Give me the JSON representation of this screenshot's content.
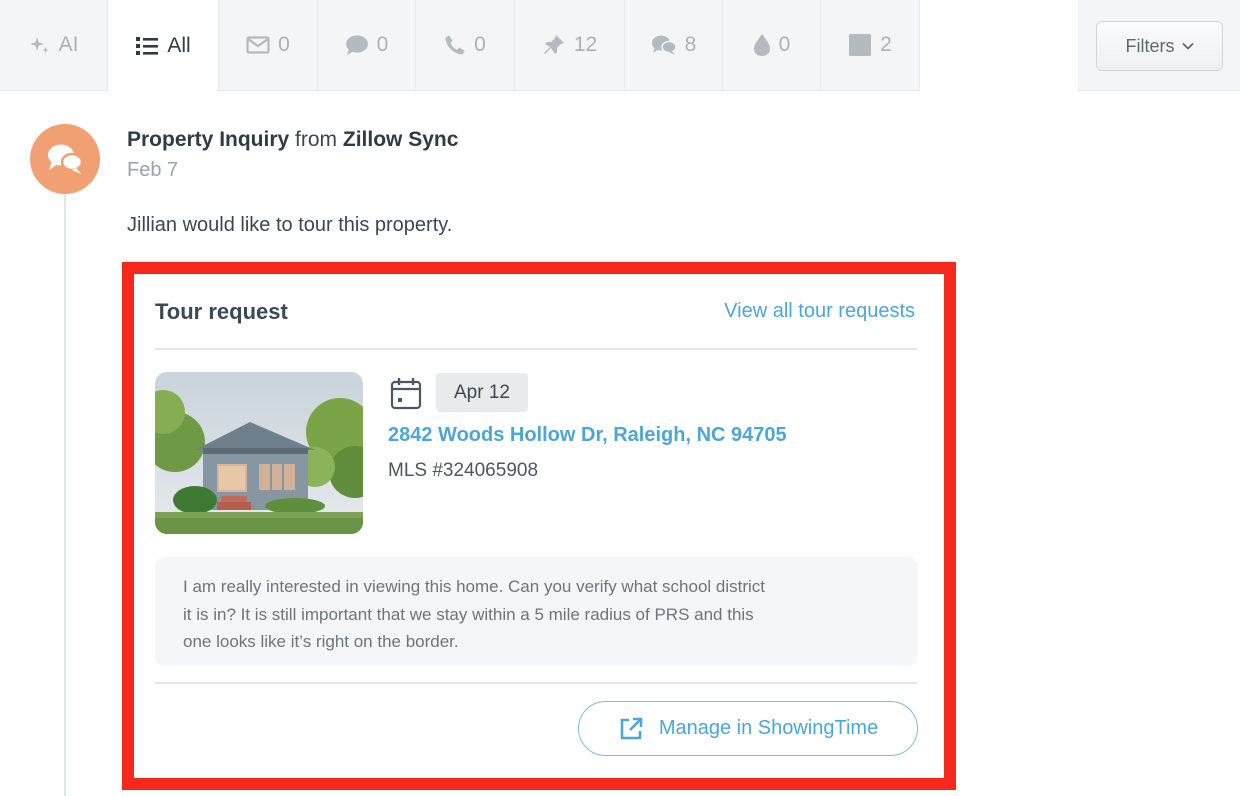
{
  "tabs": [
    {
      "label": "AI",
      "icon": "sparkle-icon"
    },
    {
      "label": "All",
      "icon": "list-icon"
    },
    {
      "label": "0",
      "icon": "email-icon"
    },
    {
      "label": "0",
      "icon": "chat-icon"
    },
    {
      "label": "0",
      "icon": "phone-icon"
    },
    {
      "label": "12",
      "icon": "pin-icon"
    },
    {
      "label": "8",
      "icon": "conversation-icon"
    },
    {
      "label": "0",
      "icon": "drop-icon"
    },
    {
      "label": "2",
      "icon": "square-icon"
    }
  ],
  "active_tab": "All",
  "filters_label": "Filters",
  "event": {
    "title_bold": "Property Inquiry",
    "title_from": "from",
    "source": "Zillow Sync",
    "date": "Feb 7",
    "body": "Jillian would like to tour this property."
  },
  "card": {
    "title": "Tour request",
    "view_all_link": "View all tour requests",
    "tour_date": "Apr 12",
    "address": "2842 Woods Hollow Dr, Raleigh, NC 94705",
    "mls": "MLS #324065908",
    "message_lines": [
      "I am really interested in viewing this home. Can you verify what school district",
      "it is in? It is still important that we stay within a 5 mile radius of PRS and this",
      "one looks like it’s right on the border."
    ],
    "manage_button": "Manage in ShowingTime"
  },
  "colors": {
    "accent_blue": "#4da6d8",
    "avatar_orange": "#f1a074",
    "highlight_red": "#f5281b"
  }
}
